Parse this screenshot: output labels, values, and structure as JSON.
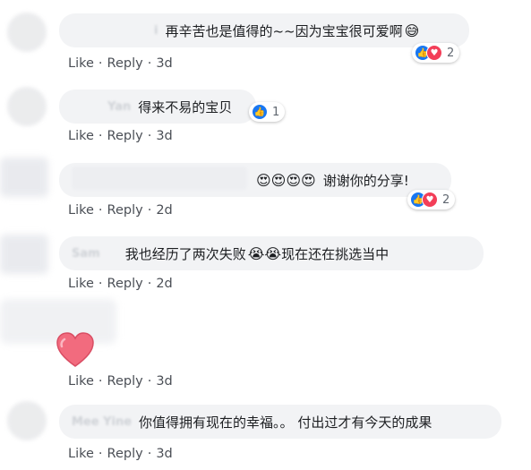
{
  "actions": {
    "like": "Like",
    "reply": "Reply",
    "dot": "·"
  },
  "comments": [
    {
      "author": "i",
      "text": "再辛苦也是值得的~~因为宝宝很可爱啊",
      "emoji": "😅",
      "time": "3d",
      "reaction_count": "2"
    },
    {
      "author": "Yan",
      "text": "得来不易的宝贝",
      "time": "3d",
      "reaction_count": "1"
    },
    {
      "text": "谢谢你的分享!",
      "emoji": "😍😍😍😍",
      "time": "2d",
      "reaction_count": "2"
    },
    {
      "author": "Sam",
      "text": "我也经历了两次失败",
      "emoji": "😭😭",
      "text2": "现在还在挑选当中",
      "time": "2d"
    },
    {
      "time": "3d",
      "sticker": "heart-sticker"
    },
    {
      "author": "Mee Yine",
      "text": "你值得拥有现在的幸福。。 付出过才有今天的成果",
      "time": "3d"
    }
  ],
  "colors": {
    "like": "#1877f2",
    "love": "#f33e58",
    "bubble": "#f2f3f5"
  }
}
